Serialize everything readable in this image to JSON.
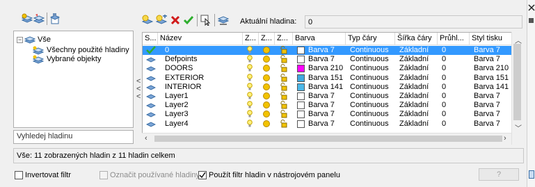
{
  "toolbar_left": {
    "icons": [
      "new-property-filter-icon",
      "new-group-filter-icon",
      "layer-states-manager-icon"
    ]
  },
  "toolbar_main": {
    "icons": [
      "new-layer-icon",
      "new-layer-vp-frozen-icon",
      "delete-layer-icon",
      "set-current-icon",
      "select-layers-icon",
      "layer-settings-icon"
    ],
    "current_layer_label": "Aktuální hladina:",
    "current_layer_value": "0"
  },
  "tree": {
    "root_label": "Vše",
    "children": [
      "Všechny použité hladiny",
      "Vybrané objekty"
    ]
  },
  "search": {
    "placeholder": "Vyhledej hladinu"
  },
  "columns": [
    "S...",
    "Název",
    "Z...",
    "Z...",
    "Z...",
    "Barva",
    "Typ čáry",
    "Šířka čáry",
    "Průhl...",
    "Styl tisku"
  ],
  "rows": [
    {
      "status": "current",
      "name": "0",
      "color_name": "Barva 7",
      "color_hex": "#ffffff",
      "linetype": "Continuous",
      "lineweight": "Základní",
      "transparency": "0",
      "plotstyle": "Barva 7",
      "selected": true
    },
    {
      "status": "layer",
      "name": "Defpoints",
      "color_name": "Barva 7",
      "color_hex": "#ffffff",
      "linetype": "Continuous",
      "lineweight": "Základní",
      "transparency": "0",
      "plotstyle": "Barva 7",
      "selected": false
    },
    {
      "status": "layer",
      "name": "DOORS",
      "color_name": "Barva 210",
      "color_hex": "#ff00ff",
      "linetype": "Continuous",
      "lineweight": "Základní",
      "transparency": "0",
      "plotstyle": "Barva 210",
      "selected": false
    },
    {
      "status": "layer",
      "name": "EXTERIOR",
      "color_name": "Barva 151",
      "color_hex": "#3fa9e0",
      "linetype": "Continuous",
      "lineweight": "Základní",
      "transparency": "0",
      "plotstyle": "Barva 151",
      "selected": false
    },
    {
      "status": "layer",
      "name": "INTERIOR",
      "color_name": "Barva 141",
      "color_hex": "#4cb8e8",
      "linetype": "Continuous",
      "lineweight": "Základní",
      "transparency": "0",
      "plotstyle": "Barva 141",
      "selected": false
    },
    {
      "status": "layer",
      "name": "Layer1",
      "color_name": "Barva 7",
      "color_hex": "#ffffff",
      "linetype": "Continuous",
      "lineweight": "Základní",
      "transparency": "0",
      "plotstyle": "Barva 7",
      "selected": false
    },
    {
      "status": "layer",
      "name": "Layer2",
      "color_name": "Barva 7",
      "color_hex": "#ffffff",
      "linetype": "Continuous",
      "lineweight": "Základní",
      "transparency": "0",
      "plotstyle": "Barva 7",
      "selected": false
    },
    {
      "status": "layer",
      "name": "Layer3",
      "color_name": "Barva 7",
      "color_hex": "#ffffff",
      "linetype": "Continuous",
      "lineweight": "Základní",
      "transparency": "0",
      "plotstyle": "Barva 7",
      "selected": false
    },
    {
      "status": "layer",
      "name": "Layer4",
      "color_name": "Barva 7",
      "color_hex": "#ffffff",
      "linetype": "Continuous",
      "lineweight": "Základní",
      "transparency": "0",
      "plotstyle": "Barva 7",
      "selected": false
    }
  ],
  "status_text": "Vše: 11 zobrazených hladin z 11 hladin celkem",
  "options": {
    "invert_filter": {
      "label": "Invertovat filtr",
      "checked": false
    },
    "indicate_used": {
      "label": "Označit používané hladiny",
      "checked": false,
      "disabled": true
    },
    "apply_to_toolbar": {
      "label": "Použít filtr hladin v nástrojovém panelu",
      "checked": true
    }
  },
  "help_button": "?",
  "collapse_arrows": [
    "<",
    "<",
    "<"
  ],
  "colors": {
    "selection": "#3399ff",
    "accent_check": "#2eae2e",
    "delete_red": "#d11b1b"
  }
}
